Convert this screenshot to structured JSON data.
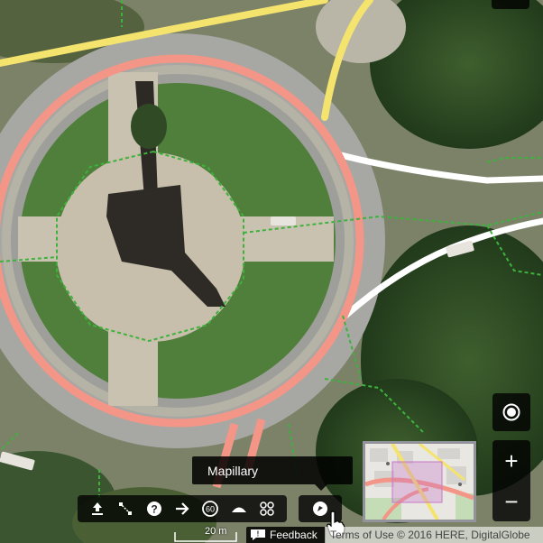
{
  "map": {
    "colors": {
      "trunk": "#f39687",
      "primary": "#f4e46e",
      "footway": "#3db23d",
      "white_road": "#ffffff",
      "grass": "#4f7f3a",
      "plaza": "#c6bfae",
      "asphalt": "#a9a9a6"
    }
  },
  "toolbar": {
    "items": [
      {
        "name": "upload-icon"
      },
      {
        "name": "measure-icon"
      },
      {
        "name": "help-icon"
      },
      {
        "name": "arrow-icon"
      },
      {
        "name": "speed-limit-icon",
        "label": "60"
      },
      {
        "name": "elevation-icon"
      },
      {
        "name": "layers-icon"
      }
    ]
  },
  "tooltip": {
    "text": "Mapillary"
  },
  "controls": {
    "zoom_in": "+",
    "zoom_out": "−"
  },
  "scale": {
    "label": "20 m"
  },
  "feedback": {
    "label": "Feedback"
  },
  "attribution": {
    "text": "Terms of Use © 2016 HERE, DigitalGlobe"
  }
}
